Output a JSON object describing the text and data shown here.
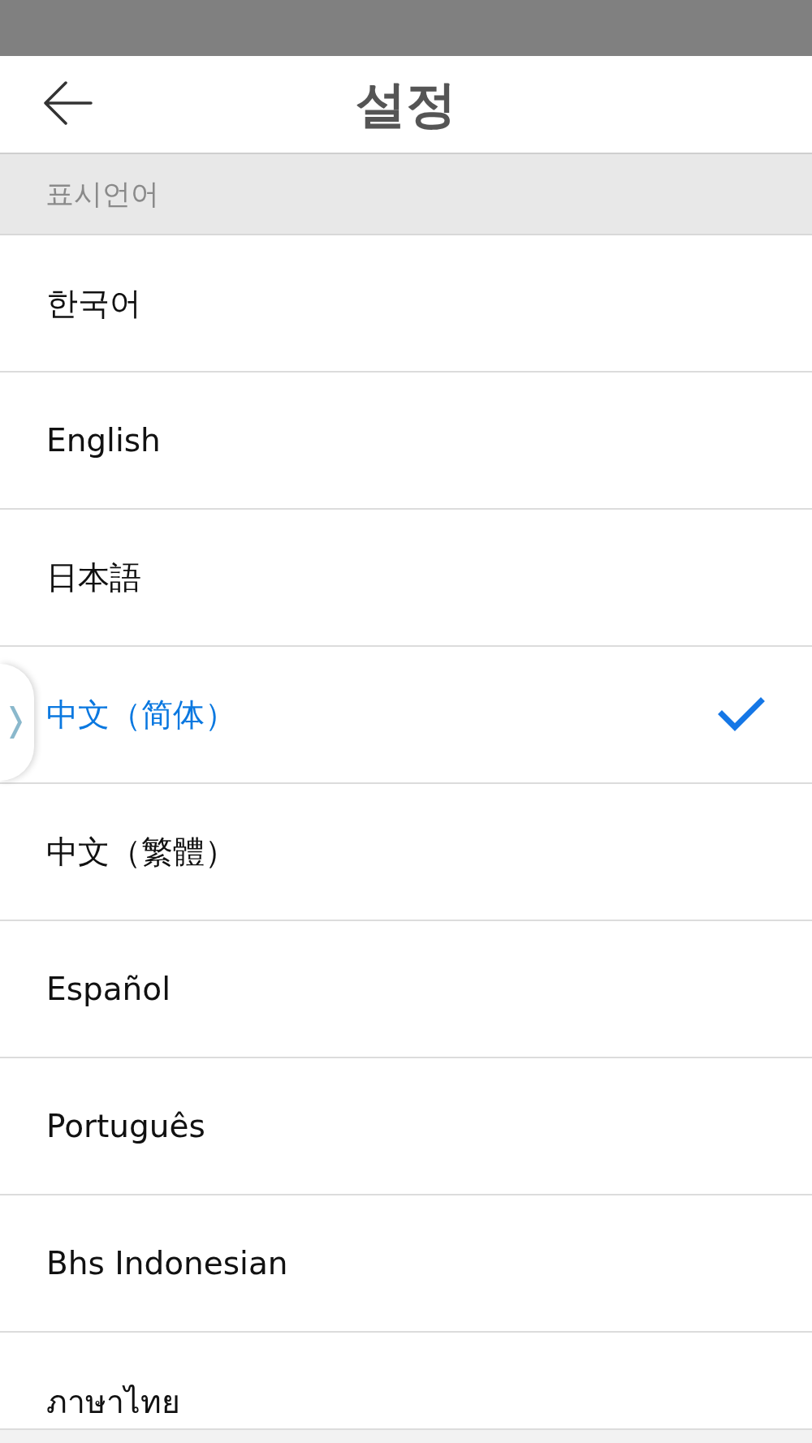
{
  "header": {
    "title": "설정"
  },
  "section": {
    "title": "표시언어"
  },
  "languages": [
    {
      "label": "한국어",
      "selected": false
    },
    {
      "label": "English",
      "selected": false
    },
    {
      "label": "日本語",
      "selected": false
    },
    {
      "label": "中文（简体）",
      "selected": true
    },
    {
      "label": "中文（繁體）",
      "selected": false
    },
    {
      "label": "Español",
      "selected": false
    },
    {
      "label": "Português",
      "selected": false
    },
    {
      "label": "Bhs Indonesian",
      "selected": false
    },
    {
      "label": "ภาษาไทย",
      "selected": false
    }
  ]
}
